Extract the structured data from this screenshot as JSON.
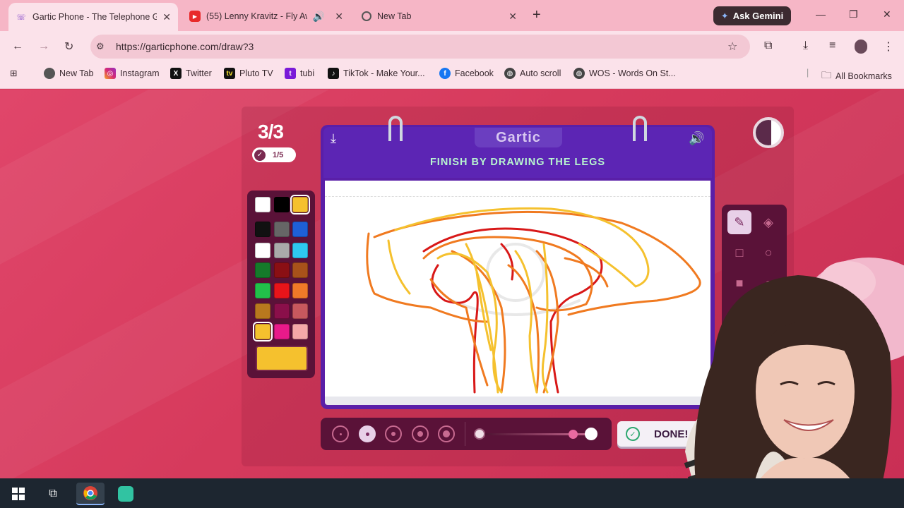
{
  "browser": {
    "tabs": [
      {
        "title": "Gartic Phone - The Telephone G",
        "active": true,
        "icon": "gartic-icon"
      },
      {
        "title": "(55) Lenny Kravitz - Fly Awa",
        "active": false,
        "icon": "youtube-icon"
      },
      {
        "title": "New Tab",
        "active": false,
        "icon": "chrome-icon"
      }
    ],
    "gemini_label": "Ask Gemini",
    "url": "https://garticphone.com/draw?3",
    "bookmarks": [
      {
        "label": "New Tab",
        "icon": "chrome-icon"
      },
      {
        "label": "Instagram",
        "icon": "instagram-icon"
      },
      {
        "label": "Twitter",
        "icon": "x-icon"
      },
      {
        "label": "Pluto TV",
        "icon": "pluto-icon"
      },
      {
        "label": "tubi",
        "icon": "tubi-icon"
      },
      {
        "label": "TikTok - Make Your...",
        "icon": "tiktok-icon"
      },
      {
        "label": "Facebook",
        "icon": "facebook-icon"
      },
      {
        "label": "Auto scroll",
        "icon": "globe-icon"
      },
      {
        "label": "WOS - Words On St...",
        "icon": "globe-icon"
      }
    ],
    "all_bookmarks_label": "All Bookmarks"
  },
  "game": {
    "round": "3/3",
    "players_done": "1/5",
    "logo": "Gartic",
    "instruction": "FINISH BY DRAWING THE LEGS",
    "done_label": "DONE!",
    "timer_fraction_remaining": 0.25,
    "selected_color": "#f5c12e",
    "palette": [
      "#ffffff",
      "#000000",
      "#f5c12e",
      "#111111",
      "#666666",
      "#1e5fd6",
      "#ffffff",
      "#aaaaaa",
      "#2ec8f0",
      "#157a2a",
      "#8a0f14",
      "#a8521a",
      "#22c04a",
      "#e8141a",
      "#f07a28",
      "#b8781e",
      "#8a0f4a",
      "#c8585e",
      "#f5c12e",
      "#e81a8a",
      "#f5a8a8"
    ],
    "tools": [
      "pencil-icon",
      "eraser-icon",
      "square-outline-icon",
      "circle-outline-icon",
      "square-fill-icon",
      "circle-fill-icon",
      "line-icon",
      "fill-bucket-icon"
    ],
    "brush_sizes": 5,
    "selected_brush_index": 1
  },
  "taskbar": {
    "apps": [
      "windows-start-icon",
      "task-view-icon",
      "chrome-icon",
      "streamlabs-icon"
    ]
  }
}
